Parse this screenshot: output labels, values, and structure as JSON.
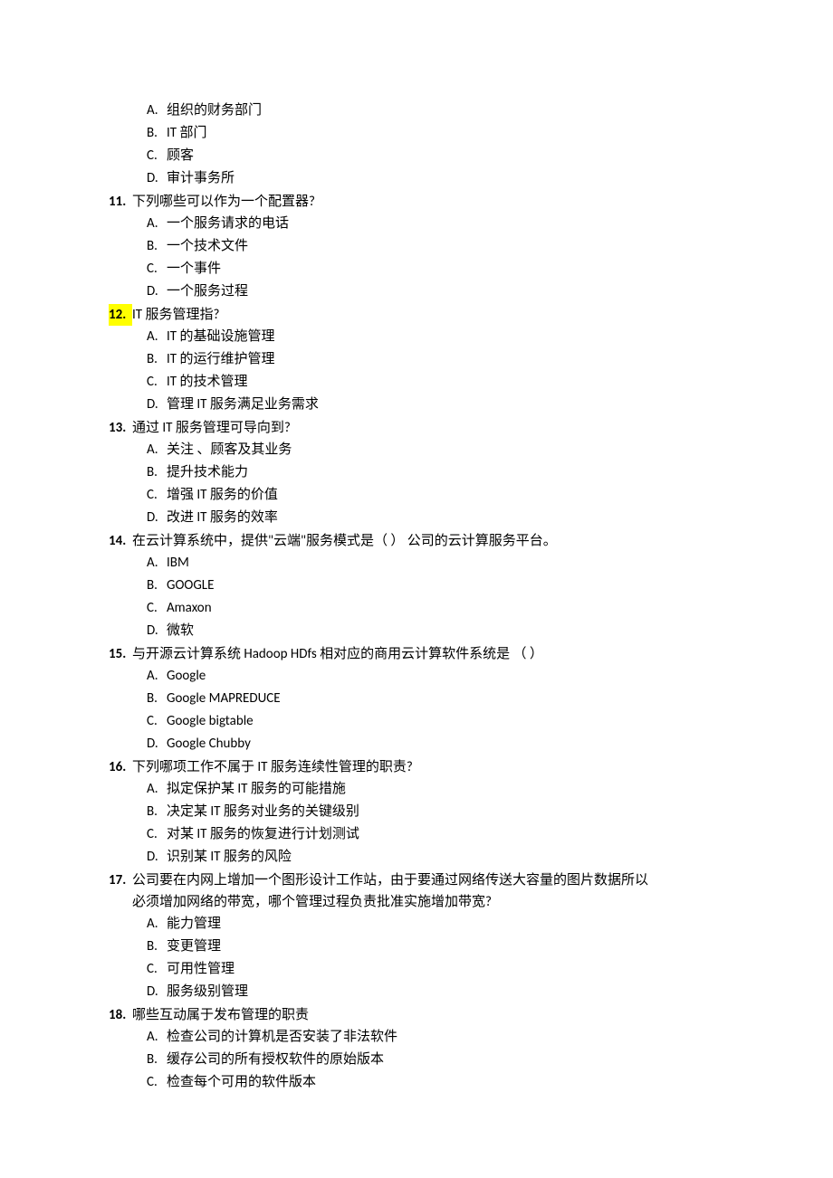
{
  "continued": {
    "options": [
      {
        "letter": "A.",
        "text": "组织的财务部门"
      },
      {
        "letter": "B.",
        "text": "IT 部门"
      },
      {
        "letter": "C.",
        "text": "顾客"
      },
      {
        "letter": "D.",
        "text": "审计事务所"
      }
    ]
  },
  "questions": [
    {
      "num": "11.",
      "text": "下列哪些可以作为一个配置器?",
      "options": [
        {
          "letter": "A.",
          "text": "一个服务请求的电话"
        },
        {
          "letter": "B.",
          "text": "一个技术文件"
        },
        {
          "letter": "C.",
          "text": "一个事件"
        },
        {
          "letter": "D.",
          "text": "一个服务过程"
        }
      ]
    },
    {
      "num": "12.",
      "highlight": true,
      "text": "IT 服务管理指?",
      "options": [
        {
          "letter": "A.",
          "text": "IT 的基础设施管理"
        },
        {
          "letter": "B.",
          "text": "IT 的运行维护管理"
        },
        {
          "letter": "C.",
          "text": "IT 的技术管理"
        },
        {
          "letter": "D.",
          "text": "管理 IT 服务满足业务需求"
        }
      ]
    },
    {
      "num": "13.",
      "text": "通过 IT 服务管理可导向到?",
      "options": [
        {
          "letter": "A.",
          "text": "关注 、顾客及其业务"
        },
        {
          "letter": "B.",
          "text": "提升技术能力"
        },
        {
          "letter": "C.",
          "text": "增强 IT 服务的价值"
        },
        {
          "letter": "D.",
          "text": "改进 IT 服务的效率"
        }
      ]
    },
    {
      "num": "14.",
      "text": "在云计算系统中，提供\"云端\"服务模式是（ ） 公司的云计算服务平台。",
      "options": [
        {
          "letter": "A.",
          "text": "IBM"
        },
        {
          "letter": "B.",
          "text": "GOOGLE"
        },
        {
          "letter": "C.",
          "text": "Amaxon"
        },
        {
          "letter": "D.",
          "text": "微软"
        }
      ]
    },
    {
      "num": "15.",
      "text": "与开源云计算系统 Hadoop HDfs 相对应的商用云计算软件系统是 （ ）",
      "options": [
        {
          "letter": "A.",
          "text": "Google"
        },
        {
          "letter": "B.",
          "text": "Google MAPREDUCE"
        },
        {
          "letter": "C.",
          "text": "Google bigtable"
        },
        {
          "letter": "D.",
          "text": "Google Chubby"
        }
      ]
    },
    {
      "num": "16.",
      "text": "下列哪项工作不属于 IT 服务连续性管理的职责?",
      "options": [
        {
          "letter": "A.",
          "text": "拟定保护某 IT 服务的可能措施"
        },
        {
          "letter": "B.",
          "text": "决定某 IT 服务对业务的关键级别"
        },
        {
          "letter": "C.",
          "text": "对某 IT 服务的恢复进行计划测试"
        },
        {
          "letter": "D.",
          "text": "识别某 IT 服务的风险"
        }
      ]
    },
    {
      "num": "17.",
      "text": "公司要在内网上增加一个图形设计工作站，由于要通过网络传送大容量的图片数据所以",
      "textCont": "必须增加网络的带宽，哪个管理过程负责批准实施增加带宽?",
      "options": [
        {
          "letter": "A.",
          "text": "能力管理"
        },
        {
          "letter": "B.",
          "text": "变更管理"
        },
        {
          "letter": "C.",
          "text": "可用性管理"
        },
        {
          "letter": "D.",
          "text": "服务级别管理"
        }
      ]
    },
    {
      "num": "18.",
      "text": "哪些互动属于发布管理的职责",
      "options": [
        {
          "letter": "A.",
          "text": "检查公司的计算机是否安装了非法软件"
        },
        {
          "letter": "B.",
          "text": "缓存公司的所有授权软件的原始版本"
        },
        {
          "letter": "C.",
          "text": "检查每个可用的软件版本"
        }
      ]
    }
  ]
}
